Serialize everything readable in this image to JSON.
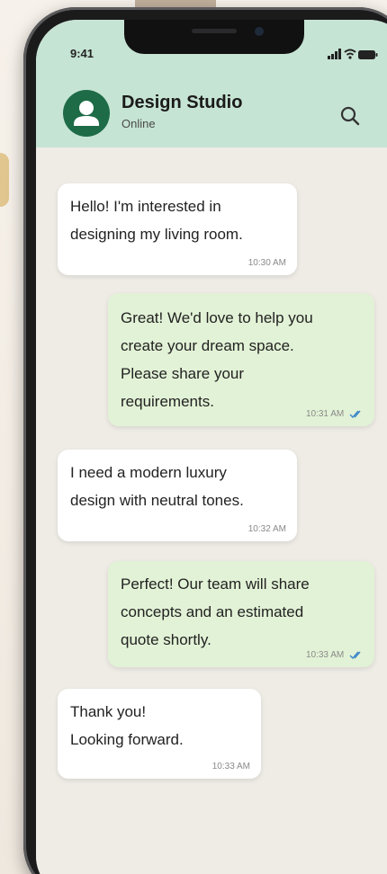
{
  "status": {
    "time": "9:41"
  },
  "header": {
    "title": "Design Studio",
    "subtitle": "Online",
    "icons": {
      "avatar": "person-icon",
      "search": "search-icon"
    }
  },
  "messages": [
    {
      "dir": "in",
      "text": "Hello! I'm interested in\ndesigning my living room.",
      "time": "10:30 AM"
    },
    {
      "dir": "out",
      "text": "Great! We'd love to help you\ncreate your dream space.\nPlease share your\nrequirements.",
      "time": "10:31 AM",
      "status": "read"
    },
    {
      "dir": "in",
      "text": "I need a modern luxury\ndesign with neutral tones.",
      "time": "10:32 AM"
    },
    {
      "dir": "out",
      "text": "Perfect! Our team will share\nconcepts and an estimated\nquote shortly.",
      "time": "10:33 AM",
      "status": "read"
    },
    {
      "dir": "in",
      "text": "Thank you!\nLooking forward.",
      "time": "10:33 AM"
    }
  ],
  "colors": {
    "header_bg": "#c6e4d4",
    "avatar_bg": "#1d6b47",
    "incoming_bubble": "#ffffff",
    "outgoing_bubble": "#e2f2d6",
    "read_check": "#3a86c8"
  }
}
